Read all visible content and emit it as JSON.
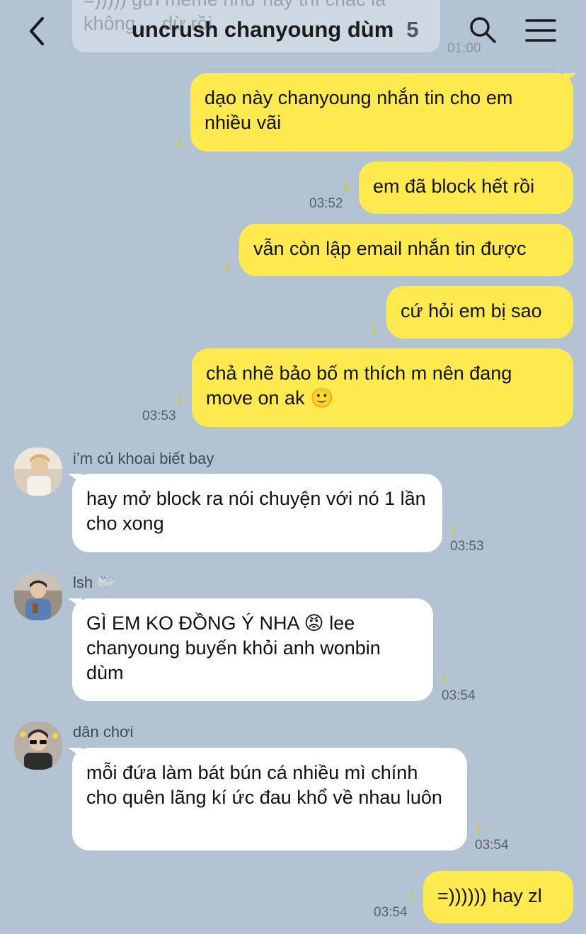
{
  "header": {
    "title": "uncrush chanyoung dùm",
    "member_count": "5"
  },
  "ghost": {
    "text": "=))))) gửi meme như này thì chắc là không ... dừ rồi",
    "time": "01:00"
  },
  "messages": [
    {
      "dir": "out",
      "text": "dạo này chanyoung nhắn tin cho em nhiều vãi",
      "read": "1",
      "time": ""
    },
    {
      "dir": "out",
      "text": "em đã block hết rồi",
      "read": "1",
      "time": "03:52"
    },
    {
      "dir": "out",
      "text": "vẫn còn lập email nhắn tin được",
      "read": "1",
      "time": ""
    },
    {
      "dir": "out",
      "text": "cứ hỏi em bị sao",
      "read": "1",
      "time": ""
    },
    {
      "dir": "out",
      "text": "chả nhẽ bảo bố m thích m nên đang move on ak 🙂",
      "read": "1",
      "time": "03:53"
    },
    {
      "dir": "in",
      "sender": "i’m củ khoai biết bay",
      "text": "hay mở block ra nói chuyện với nó 1 lần cho xong",
      "read": "1",
      "time": "03:53"
    },
    {
      "dir": "in",
      "sender": "lsh 🦭",
      "text": "GÌ EM KO ĐỒNG Ý NHA 😡 lee chanyoung buyến khỏi anh wonbin dùm",
      "read": "1",
      "time": "03:54"
    },
    {
      "dir": "in",
      "sender": "dân chơi",
      "text": "mỗi đứa làm bát bún cá nhiều mì chính cho quên lãng kí ức đau khổ về nhau luôn",
      "read": "1",
      "time": "03:54"
    },
    {
      "dir": "out",
      "text": "=)))))) hay zl",
      "read": "1",
      "time": "03:54"
    }
  ],
  "colors": {
    "background": "#b3c3d4",
    "outgoing_bubble": "#fee94f",
    "incoming_bubble": "#ffffff",
    "read_count": "#d7c61e"
  },
  "icons": {
    "back": "back-chevron-icon",
    "search": "search-icon",
    "menu": "hamburger-menu-icon"
  }
}
